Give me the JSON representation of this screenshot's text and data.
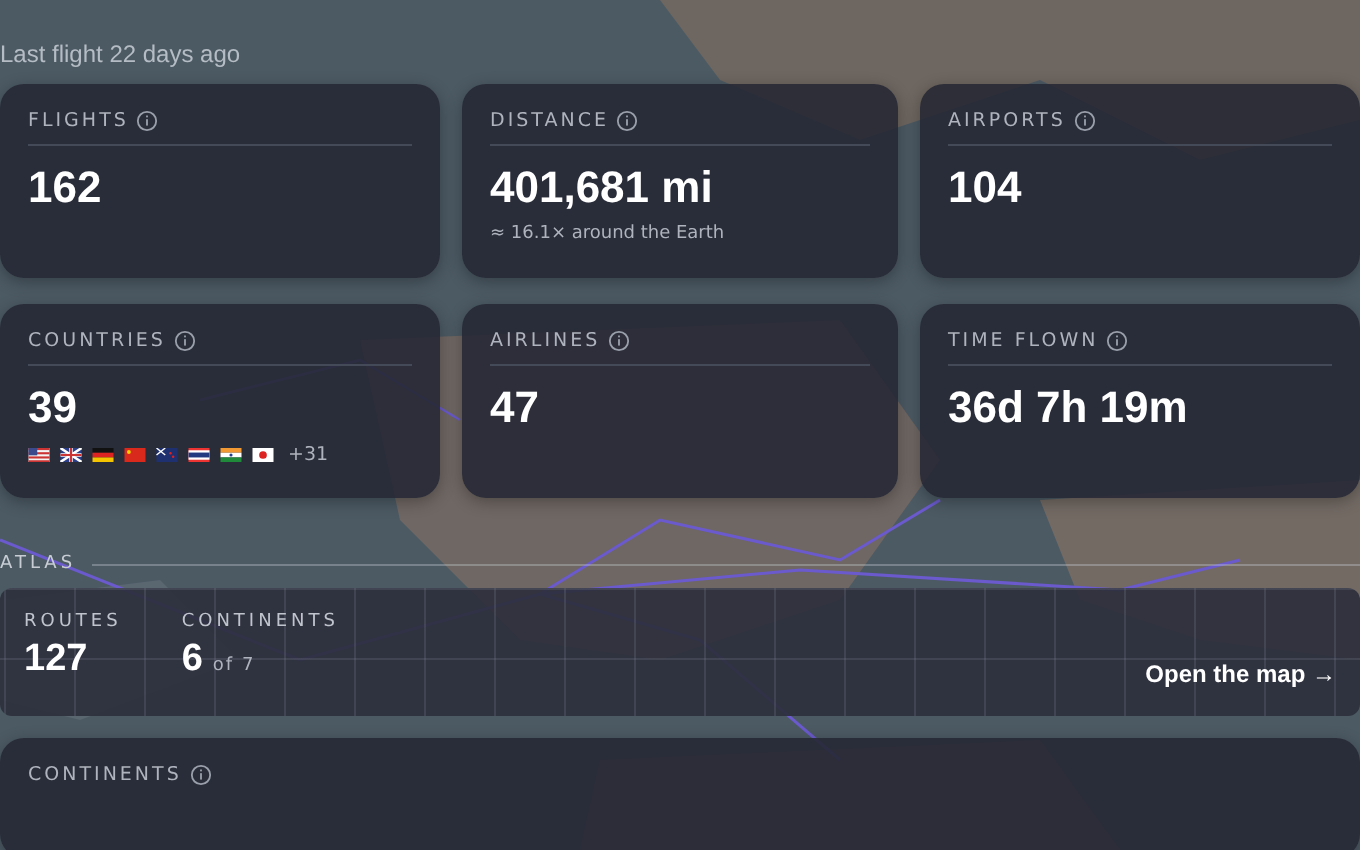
{
  "last_flight": "Last flight 22 days ago",
  "stats": [
    {
      "label": "FLIGHTS",
      "value": "162"
    },
    {
      "label": "DISTANCE",
      "value": "401,681 mi",
      "note": "≈ 16.1× around the Earth"
    },
    {
      "label": "AIRPORTS",
      "value": "104"
    },
    {
      "label": "COUNTRIES",
      "value": "39",
      "flags": [
        {
          "kind": "us"
        },
        {
          "kind": "uk"
        },
        {
          "kind": "de"
        },
        {
          "kind": "cn"
        },
        {
          "kind": "nz"
        },
        {
          "kind": "th"
        },
        {
          "kind": "in"
        },
        {
          "kind": "jp"
        }
      ],
      "more": "+31"
    },
    {
      "label": "AIRLINES",
      "value": "47"
    },
    {
      "label": "TIME FLOWN",
      "value": "36d 7h 19m"
    }
  ],
  "atlas": {
    "label": "ATLAS",
    "routes_label": "ROUTES",
    "routes": "127",
    "continents_label": "CONTINENTS",
    "continents": "6",
    "continents_of": "of 7",
    "link": "Open the map →"
  },
  "continents_card": {
    "label": "CONTINENTS"
  }
}
